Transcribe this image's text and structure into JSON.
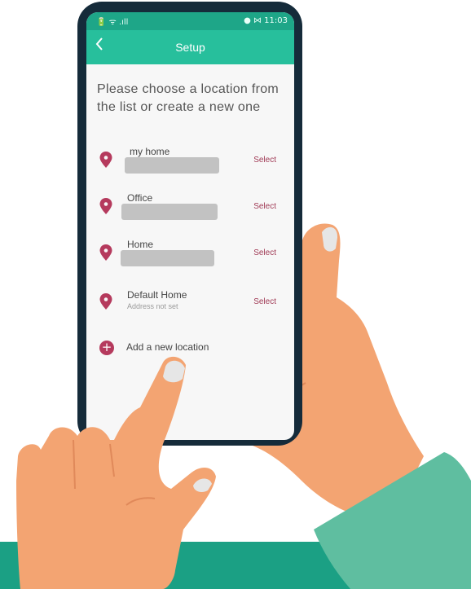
{
  "status": {
    "left": "🔋 ᯤ .ıll",
    "right": "● ⋈ 11:03"
  },
  "header": {
    "back_icon": "chevron-left-icon",
    "title": "Setup"
  },
  "prompt": "Please choose a location from the list or create a new one",
  "locations": [
    {
      "name": "my home",
      "address": "",
      "action": "Select"
    },
    {
      "name": "Office",
      "address": "",
      "action": "Select"
    },
    {
      "name": "Home",
      "address": "",
      "action": "Select"
    },
    {
      "name": "Default Home",
      "address": "Address not set",
      "action": "Select"
    }
  ],
  "add_location": {
    "icon": "plus-icon",
    "label": "Add a new location"
  },
  "colors": {
    "accent": "#27bf9c",
    "status_bar": "#1ea688",
    "pin": "#b53a5d",
    "select_text": "#a03a55",
    "phone_frame": "#152b3a",
    "band": "#1ba084",
    "skin": "#f3a472"
  }
}
